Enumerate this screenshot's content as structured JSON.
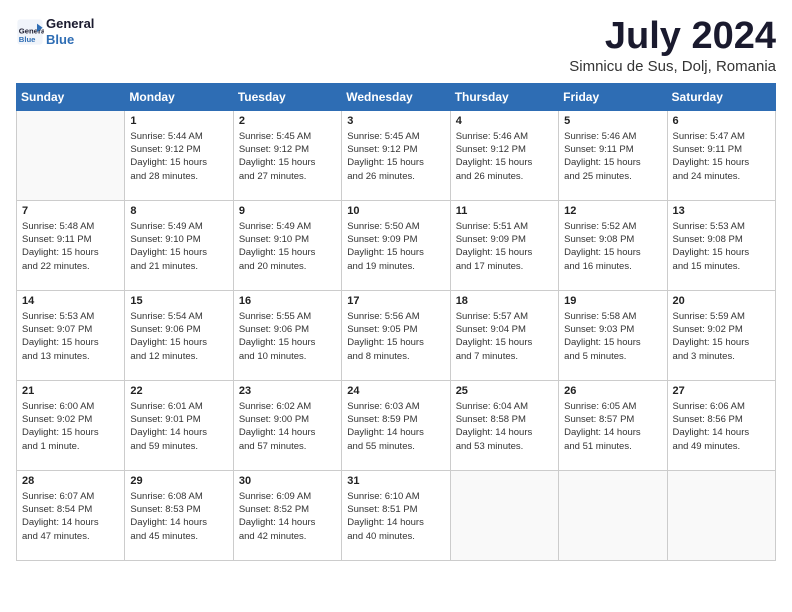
{
  "logo": {
    "line1": "General",
    "line2": "Blue"
  },
  "title": "July 2024",
  "subtitle": "Simnicu de Sus, Dolj, Romania",
  "days_header": [
    "Sunday",
    "Monday",
    "Tuesday",
    "Wednesday",
    "Thursday",
    "Friday",
    "Saturday"
  ],
  "weeks": [
    [
      {
        "day": "",
        "text": ""
      },
      {
        "day": "1",
        "text": "Sunrise: 5:44 AM\nSunset: 9:12 PM\nDaylight: 15 hours\nand 28 minutes."
      },
      {
        "day": "2",
        "text": "Sunrise: 5:45 AM\nSunset: 9:12 PM\nDaylight: 15 hours\nand 27 minutes."
      },
      {
        "day": "3",
        "text": "Sunrise: 5:45 AM\nSunset: 9:12 PM\nDaylight: 15 hours\nand 26 minutes."
      },
      {
        "day": "4",
        "text": "Sunrise: 5:46 AM\nSunset: 9:12 PM\nDaylight: 15 hours\nand 26 minutes."
      },
      {
        "day": "5",
        "text": "Sunrise: 5:46 AM\nSunset: 9:11 PM\nDaylight: 15 hours\nand 25 minutes."
      },
      {
        "day": "6",
        "text": "Sunrise: 5:47 AM\nSunset: 9:11 PM\nDaylight: 15 hours\nand 24 minutes."
      }
    ],
    [
      {
        "day": "7",
        "text": "Sunrise: 5:48 AM\nSunset: 9:11 PM\nDaylight: 15 hours\nand 22 minutes."
      },
      {
        "day": "8",
        "text": "Sunrise: 5:49 AM\nSunset: 9:10 PM\nDaylight: 15 hours\nand 21 minutes."
      },
      {
        "day": "9",
        "text": "Sunrise: 5:49 AM\nSunset: 9:10 PM\nDaylight: 15 hours\nand 20 minutes."
      },
      {
        "day": "10",
        "text": "Sunrise: 5:50 AM\nSunset: 9:09 PM\nDaylight: 15 hours\nand 19 minutes."
      },
      {
        "day": "11",
        "text": "Sunrise: 5:51 AM\nSunset: 9:09 PM\nDaylight: 15 hours\nand 17 minutes."
      },
      {
        "day": "12",
        "text": "Sunrise: 5:52 AM\nSunset: 9:08 PM\nDaylight: 15 hours\nand 16 minutes."
      },
      {
        "day": "13",
        "text": "Sunrise: 5:53 AM\nSunset: 9:08 PM\nDaylight: 15 hours\nand 15 minutes."
      }
    ],
    [
      {
        "day": "14",
        "text": "Sunrise: 5:53 AM\nSunset: 9:07 PM\nDaylight: 15 hours\nand 13 minutes."
      },
      {
        "day": "15",
        "text": "Sunrise: 5:54 AM\nSunset: 9:06 PM\nDaylight: 15 hours\nand 12 minutes."
      },
      {
        "day": "16",
        "text": "Sunrise: 5:55 AM\nSunset: 9:06 PM\nDaylight: 15 hours\nand 10 minutes."
      },
      {
        "day": "17",
        "text": "Sunrise: 5:56 AM\nSunset: 9:05 PM\nDaylight: 15 hours\nand 8 minutes."
      },
      {
        "day": "18",
        "text": "Sunrise: 5:57 AM\nSunset: 9:04 PM\nDaylight: 15 hours\nand 7 minutes."
      },
      {
        "day": "19",
        "text": "Sunrise: 5:58 AM\nSunset: 9:03 PM\nDaylight: 15 hours\nand 5 minutes."
      },
      {
        "day": "20",
        "text": "Sunrise: 5:59 AM\nSunset: 9:02 PM\nDaylight: 15 hours\nand 3 minutes."
      }
    ],
    [
      {
        "day": "21",
        "text": "Sunrise: 6:00 AM\nSunset: 9:02 PM\nDaylight: 15 hours\nand 1 minute."
      },
      {
        "day": "22",
        "text": "Sunrise: 6:01 AM\nSunset: 9:01 PM\nDaylight: 14 hours\nand 59 minutes."
      },
      {
        "day": "23",
        "text": "Sunrise: 6:02 AM\nSunset: 9:00 PM\nDaylight: 14 hours\nand 57 minutes."
      },
      {
        "day": "24",
        "text": "Sunrise: 6:03 AM\nSunset: 8:59 PM\nDaylight: 14 hours\nand 55 minutes."
      },
      {
        "day": "25",
        "text": "Sunrise: 6:04 AM\nSunset: 8:58 PM\nDaylight: 14 hours\nand 53 minutes."
      },
      {
        "day": "26",
        "text": "Sunrise: 6:05 AM\nSunset: 8:57 PM\nDaylight: 14 hours\nand 51 minutes."
      },
      {
        "day": "27",
        "text": "Sunrise: 6:06 AM\nSunset: 8:56 PM\nDaylight: 14 hours\nand 49 minutes."
      }
    ],
    [
      {
        "day": "28",
        "text": "Sunrise: 6:07 AM\nSunset: 8:54 PM\nDaylight: 14 hours\nand 47 minutes."
      },
      {
        "day": "29",
        "text": "Sunrise: 6:08 AM\nSunset: 8:53 PM\nDaylight: 14 hours\nand 45 minutes."
      },
      {
        "day": "30",
        "text": "Sunrise: 6:09 AM\nSunset: 8:52 PM\nDaylight: 14 hours\nand 42 minutes."
      },
      {
        "day": "31",
        "text": "Sunrise: 6:10 AM\nSunset: 8:51 PM\nDaylight: 14 hours\nand 40 minutes."
      },
      {
        "day": "",
        "text": ""
      },
      {
        "day": "",
        "text": ""
      },
      {
        "day": "",
        "text": ""
      }
    ]
  ]
}
